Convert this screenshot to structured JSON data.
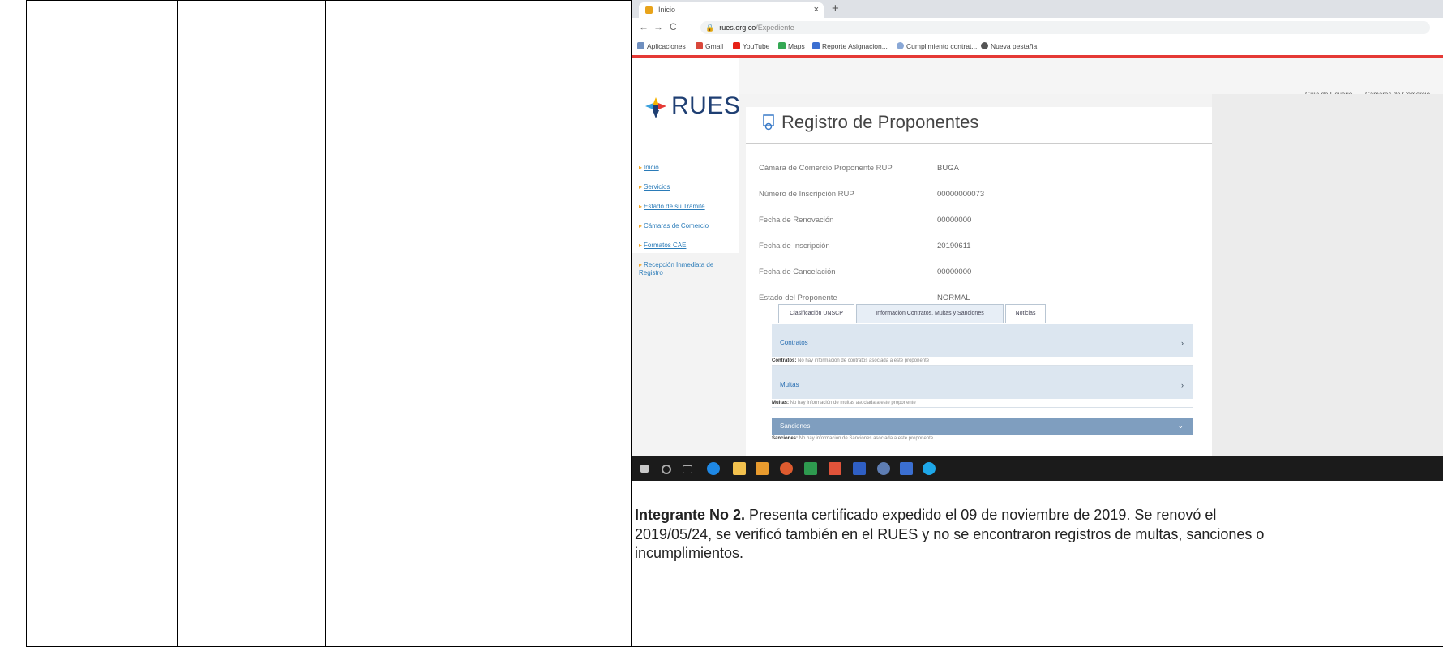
{
  "browser": {
    "tab_title": "Inicio",
    "tab_close": "×",
    "new_tab": "+",
    "url_domain": "rues.org.co",
    "url_path": "/Expediente",
    "bookmarks": [
      "Aplicaciones",
      "Gmail",
      "YouTube",
      "Maps",
      "Reporte Asignacion...",
      "Cumplimiento contrat...",
      "Nueva pestaña"
    ]
  },
  "site": {
    "logo_text": "RUES",
    "nav": [
      "Inicio",
      "Servicios",
      "Estado de su Trámite",
      "Cámaras de Comercio",
      "Formatos CAE",
      "Recepción Inmediata de Registro"
    ],
    "top_links": [
      "Guía de Usuario",
      "Cámaras de Comercio"
    ],
    "page_title": "Registro de Proponentes",
    "fields": [
      {
        "label": "Cámara de Comercio Proponente RUP",
        "value": "BUGA"
      },
      {
        "label": "Número de Inscripción RUP",
        "value": "00000000073"
      },
      {
        "label": "Fecha de Renovación",
        "value": "00000000"
      },
      {
        "label": "Fecha de Inscripción",
        "value": "20190611"
      },
      {
        "label": "Fecha de Cancelación",
        "value": "00000000"
      },
      {
        "label": "Estado del Proponente",
        "value": "NORMAL"
      }
    ],
    "tabs": [
      "Clasificación UNSCP",
      "Información Contratos, Multas y Sanciones",
      "Noticias"
    ],
    "sections": [
      {
        "title": "Contratos",
        "body_label": "Contratos:",
        "body_text": "No hay información de contratos asociada a este proponente"
      },
      {
        "title": "Multas",
        "body_label": "Multas:",
        "body_text": "No hay información de multas asociada a este proponente"
      },
      {
        "title": "Sanciones",
        "body_label": "Sanciones:",
        "body_text": "No hay información de Sanciones asociada a este proponente"
      }
    ]
  },
  "caption": {
    "lead": "Integrante No 2.",
    "text": " Presenta certificado expedido el 09 de noviembre de 2019. Se renovó el 2019/05/24, se verificó también en el RUES y no se encontraron registros de multas, sanciones o incumplimientos."
  }
}
